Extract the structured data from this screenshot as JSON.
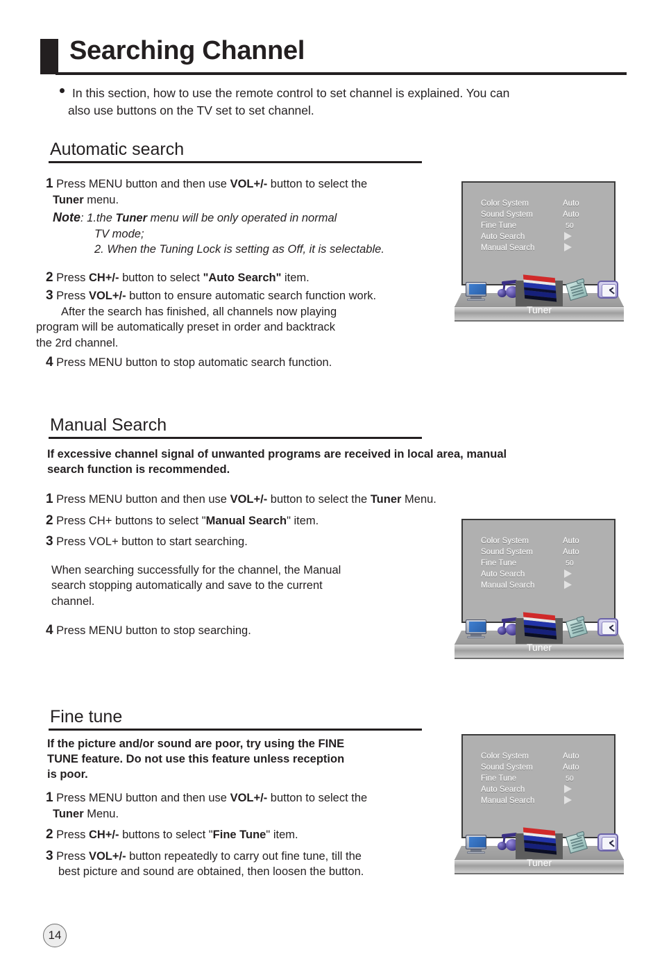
{
  "document": {
    "page_number": "14",
    "title": "Searching Channel"
  },
  "intro": {
    "line1": "In this section, how to use the remote control  to set channel is explained. You can",
    "line2": "also use buttons on the TV set to set channel."
  },
  "sections": [
    {
      "heading": "Automatic search",
      "steps": {
        "s1_num": "1",
        "s1_a": "Press MENU button and then use ",
        "s1_b": "VOL+/-",
        "s1_c": " button to select the",
        "s1_d": "Tuner",
        "s1_e": " menu.",
        "note_label": "Note",
        "note_1a": ": 1.the ",
        "note_1b": "Tuner",
        "note_1c": " menu will be only operated  in normal",
        "note_1d": "TV mode;",
        "note_2": "2. When the Tuning Lock is setting as Off, it is selectable.",
        "s2_num": "2",
        "s2_a": "Press ",
        "s2_b": "CH+/-",
        "s2_c": " button to select ",
        "s2_d": "\"Auto Search\"",
        "s2_e": " item.",
        "s3_num": "3",
        "s3_a": "Press ",
        "s3_b": "VOL+/-",
        "s3_c": " button to ensure automatic search function work.",
        "s3_l2": "After the search has finished, all channels now playing",
        "s3_l3": "program will be automatically preset in order and backtrack",
        "s3_l4": "the 2rd channel.",
        "s4_num": "4",
        "s4_a": "Press MENU button to stop automatic search function."
      }
    },
    {
      "heading": "Manual Search",
      "lead": {
        "line1": "If excessive channel signal of unwanted programs are received in local area,  manual",
        "line2": "search function is recommended."
      },
      "steps": {
        "s1_num": "1",
        "s1_a": "Press MENU button and then use ",
        "s1_b": "VOL+/-",
        "s1_c": " button to select the ",
        "s1_d": "Tuner",
        "s1_e": " Menu.",
        "s2_num": "2",
        "s2_a": "Press CH+ buttons to select \"",
        "s2_b": "Manual Search",
        "s2_c": "\" item.",
        "s3_num": "3",
        "s3_a": "Press VOL+ button to start searching.",
        "p_l1": "When searching successfully for the channel, the Manual",
        "p_l2": "search stopping automatically and save to the current",
        "p_l3": "channel.",
        "s4_num": "4",
        "s4_a": "Press MENU button to stop searching."
      }
    },
    {
      "heading": "Fine tune",
      "lead": {
        "line1": "If the picture and/or sound are poor, try using the  FINE",
        "line2": "TUNE  feature. Do not use this feature unless reception",
        "line3": "is poor."
      },
      "steps": {
        "s1_num": "1",
        "s1_a": "Press MENU button and then use ",
        "s1_b": "VOL+/-",
        "s1_c": " button to select the",
        "s1_d": "Tuner",
        "s1_e": " Menu.",
        "s2_num": "2",
        "s2_a": "Press ",
        "s2_b": "CH+/-",
        "s2_c": " buttons to select \"",
        "s2_d": "Fine Tune",
        "s2_e": "\" item.",
        "s3_num": "3",
        "s3_a": "Press ",
        "s3_b": "VOL+/-",
        "s3_c": " button repeatedly to carry out fine tune, till the",
        "s3_l2": "best picture and sound are obtained, then loosen the button."
      }
    }
  ],
  "osd": {
    "rows": [
      {
        "label": "Color System",
        "value": "Auto",
        "type": "value"
      },
      {
        "label": "Sound System",
        "value": "Auto",
        "type": "value"
      },
      {
        "label": "Fine Tune",
        "value": "50",
        "type": "number"
      },
      {
        "label": "Auto Search",
        "value": "",
        "type": "arrow"
      },
      {
        "label": "Manual Search",
        "value": "",
        "type": "arrow"
      }
    ],
    "selected_tab": "Tuner",
    "tabs": [
      {
        "name": "picture-monitor-icon"
      },
      {
        "name": "sound-note-icon"
      },
      {
        "name": "tuner-flag-icon"
      },
      {
        "name": "setup-clipboard-icon"
      },
      {
        "name": "timer-clock-icon"
      }
    ],
    "colors": {
      "screen_bg": "#b0b0b0",
      "screen_border": "#3a3a3a",
      "tab_highlight": "#5d5d5d",
      "text": "#ffffff"
    }
  }
}
